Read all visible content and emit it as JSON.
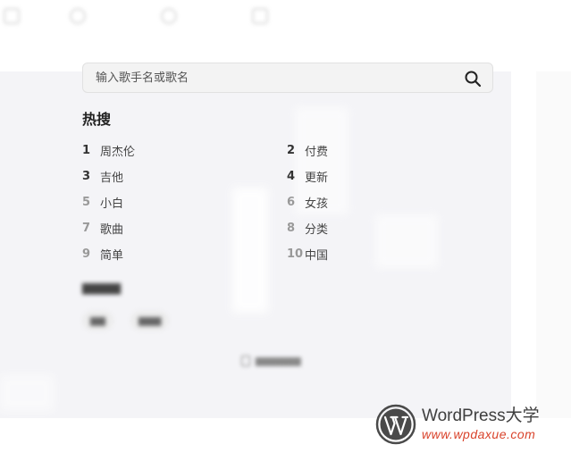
{
  "search": {
    "placeholder": "输入歌手名或歌名",
    "value": ""
  },
  "hot_search": {
    "title": "热搜",
    "items": [
      {
        "rank": "1",
        "label": "周杰伦"
      },
      {
        "rank": "2",
        "label": "付费"
      },
      {
        "rank": "3",
        "label": "吉他"
      },
      {
        "rank": "4",
        "label": "更新"
      },
      {
        "rank": "5",
        "label": "小白"
      },
      {
        "rank": "6",
        "label": "女孩"
      },
      {
        "rank": "7",
        "label": "歌曲"
      },
      {
        "rank": "8",
        "label": "分类"
      },
      {
        "rank": "9",
        "label": "简单"
      },
      {
        "rank": "10",
        "label": "中国"
      }
    ]
  },
  "watermark": {
    "brand": "WordPress大学",
    "url": "www.wpdaxue.com",
    "colors": {
      "brand": "#3e3e3e",
      "url": "#d9432b",
      "logo": "#4a4a4a"
    }
  },
  "icons": {
    "search": "search-icon",
    "logo": "wordpress-logo-icon"
  }
}
